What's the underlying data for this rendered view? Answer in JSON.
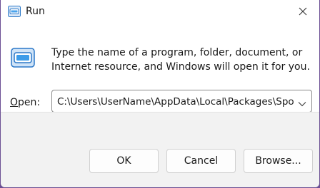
{
  "window": {
    "title": "Run"
  },
  "content": {
    "description": "Type the name of a program, folder, document, or Internet resource, and Windows will open it for you.",
    "open_label_accel": "O",
    "open_label_rest": "pen:",
    "input_value": "C:\\Users\\UserName\\AppData\\Local\\Packages\\Spo"
  },
  "buttons": {
    "ok": "OK",
    "cancel": "Cancel",
    "browse": "Browse..."
  },
  "icons": {
    "title": "run-icon",
    "app": "run-app-icon",
    "close": "close-icon",
    "dropdown": "chevron-down-icon"
  },
  "colors": {
    "accent": "#0078d4",
    "background_outside": "#6b4f93",
    "footer": "#f2f2f2"
  }
}
